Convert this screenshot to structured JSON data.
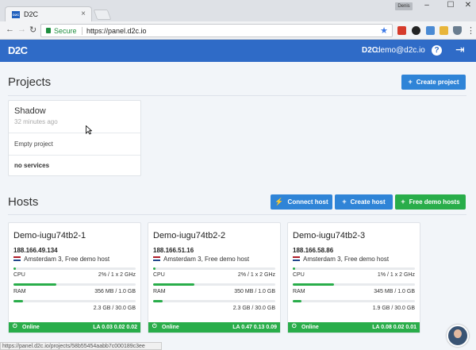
{
  "browser": {
    "tab_title": "D2C",
    "favicon_text": "D2C",
    "profile_name": "Denis",
    "secure_label": "Secure",
    "url": "https://panel.d2c.io",
    "status_url": "https://panel.d2c.io/projects/58b55454aabb7c000189c3ee"
  },
  "header": {
    "logo": "D2C",
    "user_logo": "D2C",
    "user_email": "demo@d2c.io",
    "help_icon": "?"
  },
  "projects": {
    "title": "Projects",
    "create_button": "Create project",
    "items": [
      {
        "name": "Shadow",
        "time": "32 minutes ago",
        "description": "Empty project",
        "services": "no services"
      }
    ]
  },
  "hosts": {
    "title": "Hosts",
    "buttons": {
      "connect": "Connect host",
      "create": "Create host",
      "free": "Free demo hosts"
    },
    "items": [
      {
        "name": "Demo-iugu74tb2-1",
        "ip": "188.166.49.134",
        "location": "Amsterdam 3, Free demo host",
        "cpu_label": "CPU",
        "cpu_value": "2% / 1 x 2 GHz",
        "cpu_pct": 0.02,
        "ram_label": "RAM",
        "ram_value": "356 MB / 1.0 GB",
        "ram_pct": 0.35,
        "disk_value": "2.3 GB / 30.0 GB",
        "disk_pct": 0.08,
        "status": "Online",
        "la": "LA 0.03 0.02 0.02"
      },
      {
        "name": "Demo-iugu74tb2-2",
        "ip": "188.166.51.16",
        "location": "Amsterdam 3, Free demo host",
        "cpu_label": "CPU",
        "cpu_value": "2% / 1 x 2 GHz",
        "cpu_pct": 0.02,
        "ram_label": "RAM",
        "ram_value": "350 MB / 1.0 GB",
        "ram_pct": 0.34,
        "disk_value": "2.3 GB / 30.0 GB",
        "disk_pct": 0.08,
        "status": "Online",
        "la": "LA 0.47 0.13 0.09"
      },
      {
        "name": "Demo-iugu74tb2-3",
        "ip": "188.166.58.86",
        "location": "Amsterdam 3, Free demo host",
        "cpu_label": "CPU",
        "cpu_value": "1% / 1 x 2 GHz",
        "cpu_pct": 0.01,
        "ram_label": "RAM",
        "ram_value": "345 MB / 1.0 GB",
        "ram_pct": 0.34,
        "disk_value": "1.9 GB / 30.0 GB",
        "disk_pct": 0.07,
        "status": "Online",
        "la": "LA 0.08 0.02 0.01"
      }
    ]
  },
  "colors": {
    "brand": "#2f6bc7",
    "button_blue": "#2f84d7",
    "online_green": "#29ad4a"
  }
}
